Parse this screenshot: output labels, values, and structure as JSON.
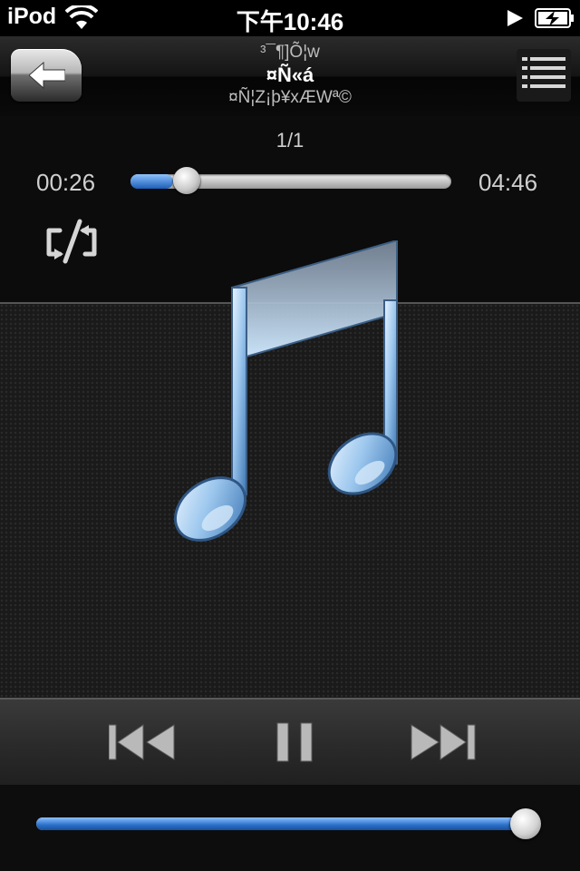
{
  "status_bar": {
    "carrier": "iPod",
    "time": "下午10:46",
    "icons": [
      "wifi-icon",
      "play-indicator-icon",
      "battery-charging-icon"
    ]
  },
  "nav": {
    "subtitle": "³¯¶]Õ¦w",
    "title": "¤Ñ«á",
    "album": "¤Ñ¦Z¡þ¥xÆWª©",
    "back_icon": "back-arrow-icon",
    "list_icon": "track-list-icon"
  },
  "player": {
    "track_count": "1/1",
    "elapsed": "00:26",
    "total": "04:46",
    "progress_fraction": 0.09,
    "shuffle_icon": "shuffle-icon"
  },
  "artwork": {
    "icon": "music-note-icon"
  },
  "transport": {
    "prev_icon": "previous-track-icon",
    "pause_icon": "pause-icon",
    "next_icon": "next-track-icon"
  },
  "volume": {
    "level_fraction": 1.0
  },
  "colors": {
    "accent_blue": "#2a6fc9",
    "background": "#111111"
  }
}
